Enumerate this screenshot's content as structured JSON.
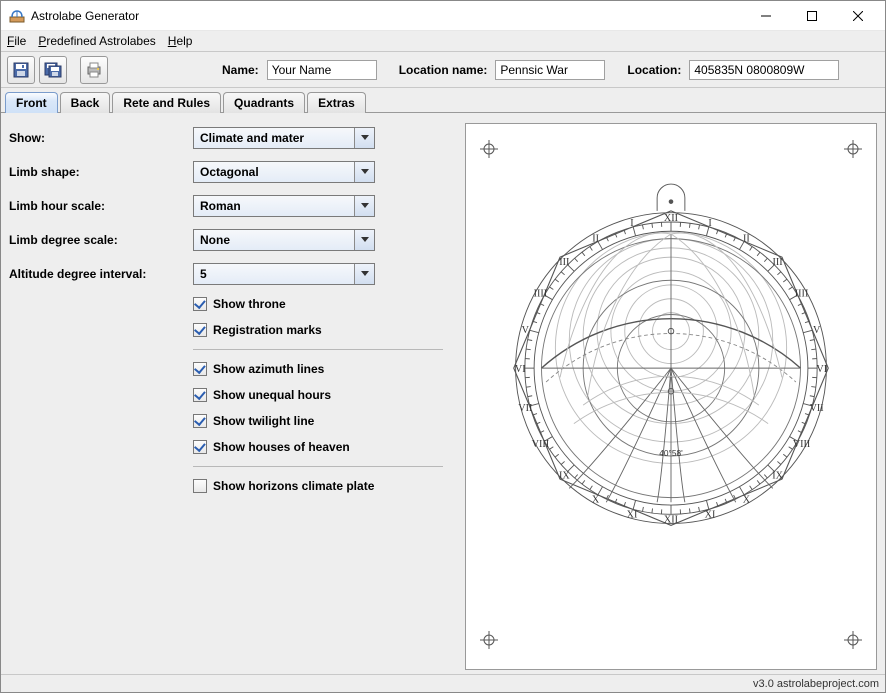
{
  "window": {
    "title": "Astrolabe Generator"
  },
  "menubar": {
    "file": "File",
    "predefined": "Predefined Astrolabes",
    "help": "Help"
  },
  "toolbar_icons": {
    "save": "save-icon",
    "save_all": "save-all-icon",
    "print": "print-icon"
  },
  "header": {
    "name_label": "Name:",
    "name_value": "Your Name",
    "location_name_label": "Location name:",
    "location_name_value": "Pennsic War",
    "location_label": "Location:",
    "location_value": "405835N 0800809W"
  },
  "tabs": [
    {
      "label": "Front",
      "active": true
    },
    {
      "label": "Back",
      "active": false
    },
    {
      "label": "Rete and Rules",
      "active": false
    },
    {
      "label": "Quadrants",
      "active": false
    },
    {
      "label": "Extras",
      "active": false
    }
  ],
  "form": {
    "show": {
      "label": "Show:",
      "value": "Climate and mater"
    },
    "limb_shape": {
      "label": "Limb shape:",
      "value": "Octagonal"
    },
    "limb_hour_scale": {
      "label": "Limb hour scale:",
      "value": "Roman"
    },
    "limb_degree_scale": {
      "label": "Limb degree scale:",
      "value": "None"
    },
    "altitude_interval": {
      "label": "Altitude degree interval:",
      "value": "5"
    }
  },
  "checks": {
    "throne": {
      "label": "Show throne",
      "checked": true
    },
    "registration": {
      "label": "Registration marks",
      "checked": true
    },
    "azimuth": {
      "label": "Show azimuth lines",
      "checked": true
    },
    "unequal": {
      "label": "Show unequal hours",
      "checked": true
    },
    "twilight": {
      "label": "Show twilight line",
      "checked": true
    },
    "houses": {
      "label": "Show houses of heaven",
      "checked": true
    },
    "horizons": {
      "label": "Show horizons climate plate",
      "checked": false
    }
  },
  "preview": {
    "latitude_label": "40°58'"
  },
  "status": {
    "version": "v3.0 astrolabeproject.com"
  }
}
